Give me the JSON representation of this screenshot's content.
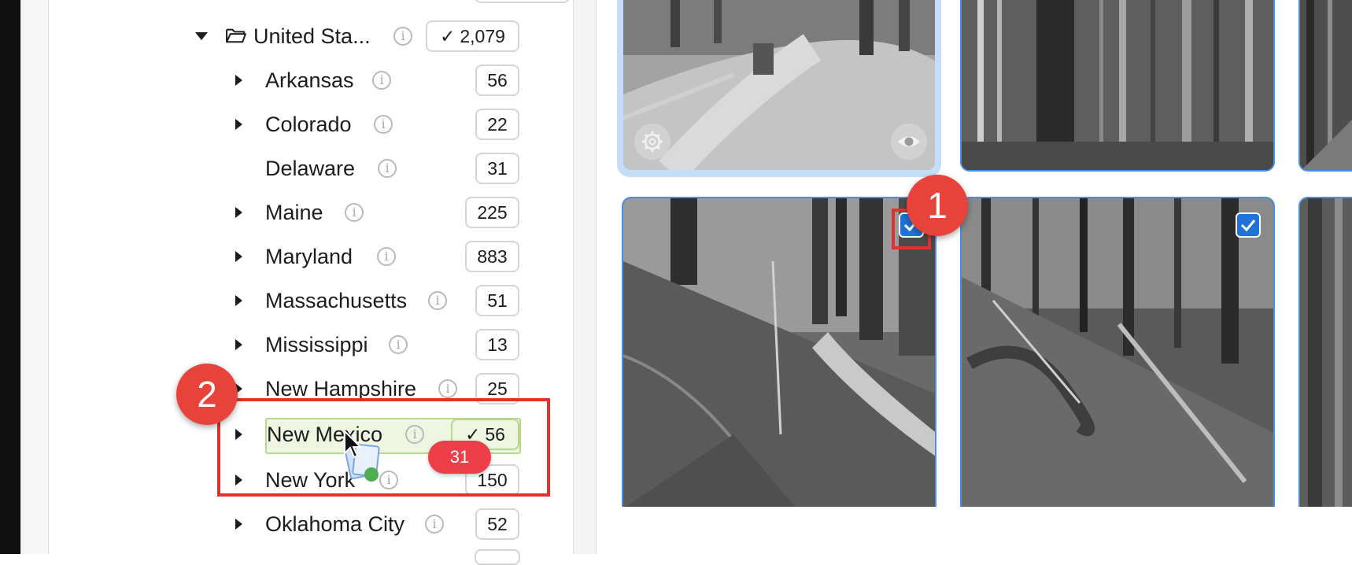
{
  "sidebar": {
    "root": {
      "label": "United Sta...",
      "count": "2,079",
      "checked": true,
      "expanded": true
    },
    "items": [
      {
        "label": "Arkansas",
        "count": "56",
        "has_children": true
      },
      {
        "label": "Colorado",
        "count": "22",
        "has_children": true
      },
      {
        "label": "Delaware",
        "count": "31",
        "has_children": false
      },
      {
        "label": "Maine",
        "count": "225",
        "has_children": true
      },
      {
        "label": "Maryland",
        "count": "883",
        "has_children": true
      },
      {
        "label": "Massachusetts",
        "count": "51",
        "has_children": true
      },
      {
        "label": "Mississippi",
        "count": "13",
        "has_children": true
      },
      {
        "label": "New Hampshire",
        "count": "25",
        "has_children": true
      },
      {
        "label": "New Mexico",
        "count": "56",
        "has_children": true,
        "checked": true,
        "drop_target": true
      },
      {
        "label": "New York",
        "count": "150",
        "has_children": true
      },
      {
        "label": "Oklahoma City",
        "count": "52",
        "has_children": true
      }
    ]
  },
  "drag": {
    "count": "31"
  },
  "annotations": {
    "badge1": "1",
    "badge2": "2"
  },
  "icons": {
    "info": "info-circle-icon",
    "expand": "triangle-right-icon",
    "collapse": "triangle-down-icon",
    "folder": "folder-open-icon",
    "check": "checkmark-icon",
    "settings": "gear-icon",
    "preview": "eye-icon"
  },
  "colors": {
    "accent": "#1e72d8",
    "annotation": "#e0312c",
    "drop_highlight": "#eef6e2",
    "drag_badge": "#ee3e49"
  },
  "photos": [
    {
      "checked": false,
      "focused": true
    },
    {
      "checked": false
    },
    {
      "checked": false
    },
    {
      "checked": true
    },
    {
      "checked": true
    },
    {
      "checked": false
    }
  ]
}
